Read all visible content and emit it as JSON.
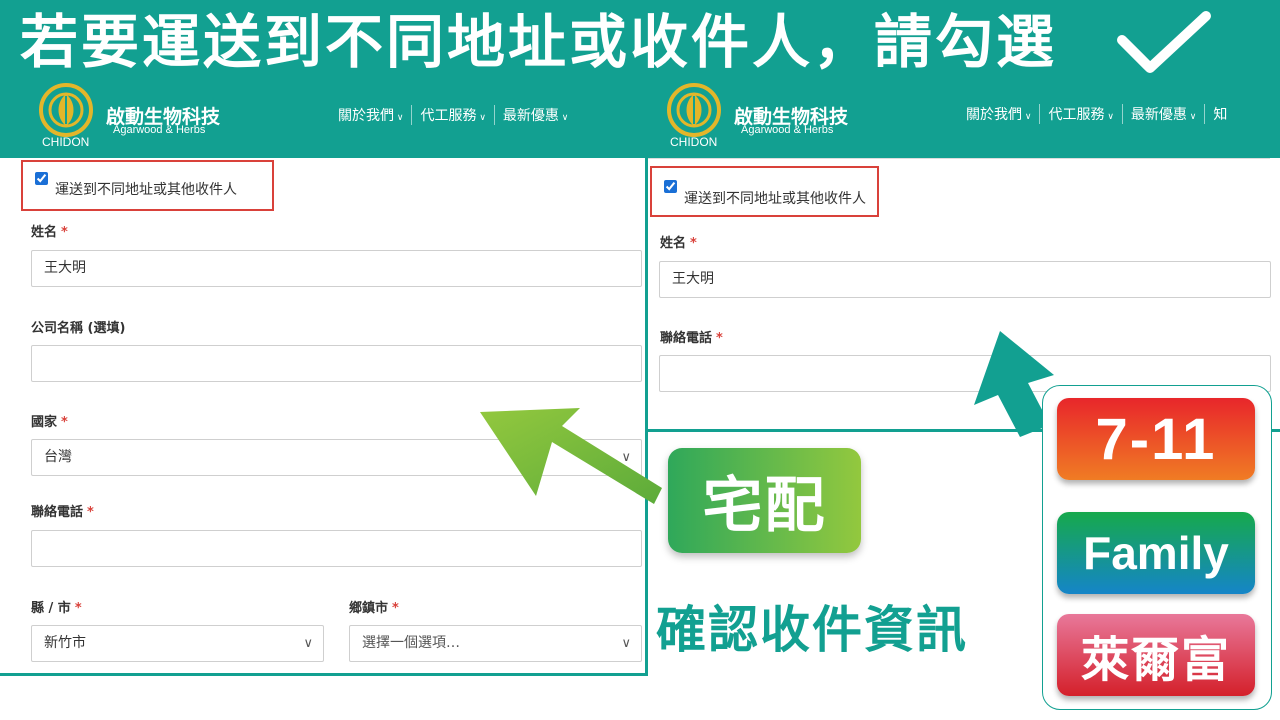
{
  "banner": {
    "title": "若要運送到不同地址或收件人，請勾選"
  },
  "brand": {
    "logo_sub": "CHIDON",
    "name": "啟動生物科技",
    "tagline": "Agarwood & Herbs"
  },
  "nav_left": [
    "關於我們",
    "代工服務",
    "最新優惠"
  ],
  "nav_right": [
    "關於我們",
    "代工服務",
    "最新優惠",
    "知"
  ],
  "left_form": {
    "ship_checkbox_label": "運送到不同地址或其他收件人",
    "name_label": "姓名",
    "name_value": "王大明",
    "company_label": "公司名稱 (選填)",
    "country_label": "國家",
    "country_value": "台灣",
    "phone_label": "聯絡電話",
    "county_label": "縣 / 市",
    "county_value": "新竹市",
    "town_label": "鄉鎮市",
    "town_placeholder": "選擇一個選項…"
  },
  "right_form": {
    "ship_checkbox_label": "運送到不同地址或其他收件人",
    "name_label": "姓名",
    "name_value": "王大明",
    "phone_label": "聯絡電話"
  },
  "required_mark": "*",
  "delivery_badge": "宅配",
  "confirm_text": "確認收件資訊",
  "stores": [
    "7-11",
    "Family",
    "萊爾富"
  ],
  "colors": {
    "teal": "#12a091",
    "highlight_red": "#d9413a",
    "delivery_green": "#2fa85a",
    "seven_eleven": "#e8262b",
    "family_mart": "#16a94c",
    "hilife": "#d4202a"
  }
}
